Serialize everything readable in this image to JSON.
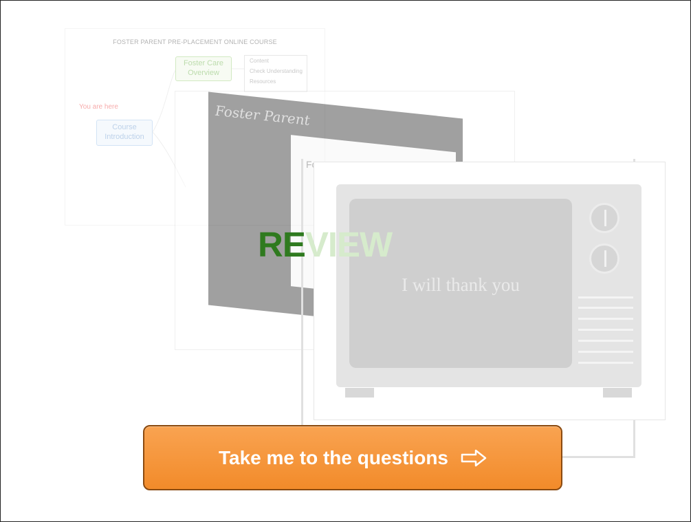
{
  "background": {
    "mindmap": {
      "title": "FOSTER PARENT PRE-PLACEMENT ONLINE COURSE",
      "node_overview": "Foster Care Overview",
      "node_intro": "Course Introduction",
      "sub_items": [
        "Content",
        "Check Understanding",
        "Resources"
      ],
      "marker": "You are here"
    },
    "screenshot": {
      "brand": "Foster Parent",
      "partial_heading": "Fo"
    }
  },
  "tv": {
    "text": "I will thank you"
  },
  "review": {
    "dark_part": "RE",
    "light_part": "VIEW"
  },
  "cta": {
    "label": "Take me to the questions",
    "icon": "right-arrow-icon"
  },
  "colors": {
    "review_green": "#2f7a1f",
    "button_orange": "#f7973e",
    "button_border": "#8a4a10"
  }
}
